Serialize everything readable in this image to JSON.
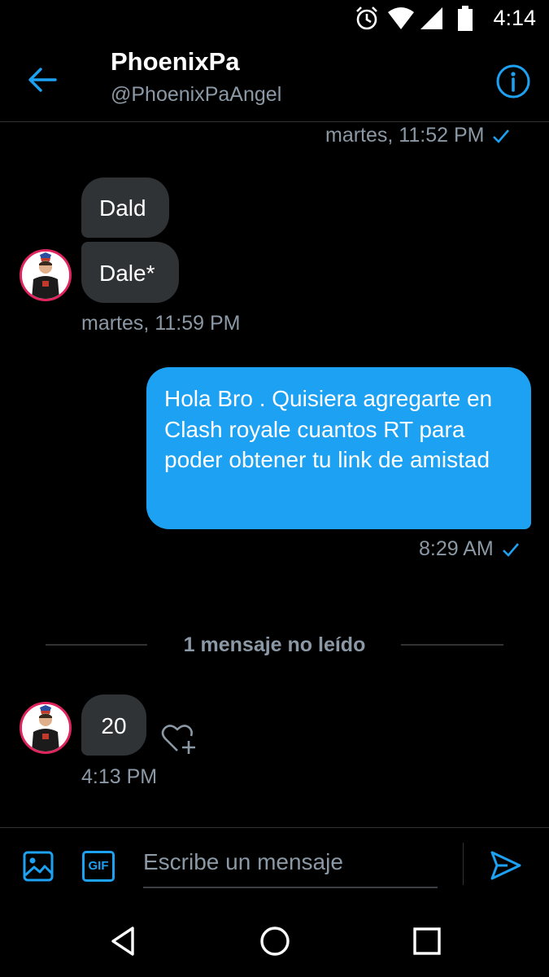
{
  "status_bar": {
    "time": "4:14",
    "icons": [
      "alarm-icon",
      "wifi-icon",
      "signal-icon",
      "battery-icon"
    ]
  },
  "header": {
    "name": "PhoenixPa",
    "handle": "@PhoenixPaAngel",
    "back_icon": "arrow-left-icon",
    "info_icon": "info-icon"
  },
  "messages": {
    "ts_top": "martes, 11:52 PM",
    "incoming_1": "Dald",
    "incoming_2": "Dale*",
    "ts_incoming_1": "martes, 11:59 PM",
    "outgoing_1": "Hola Bro . Quisiera agregarte en Clash royale cuantos RT para poder obtener tu link de amistad",
    "ts_outgoing_1": "8:29 AM",
    "unread_divider": "1 mensaje no leído",
    "incoming_3": "20",
    "ts_incoming_3": "4:13 PM"
  },
  "composer": {
    "placeholder": "Escribe un mensaje",
    "image_icon": "image-icon",
    "gif_label": "GIF",
    "send_icon": "send-icon"
  },
  "nav": [
    "back-triangle-icon",
    "home-circle-icon",
    "recents-square-icon"
  ],
  "colors": {
    "accent": "#1da1f2",
    "background": "#000000",
    "incoming_bubble": "#2f3336",
    "muted_text": "#8b98a5",
    "avatar_ring": "#e0245e"
  }
}
